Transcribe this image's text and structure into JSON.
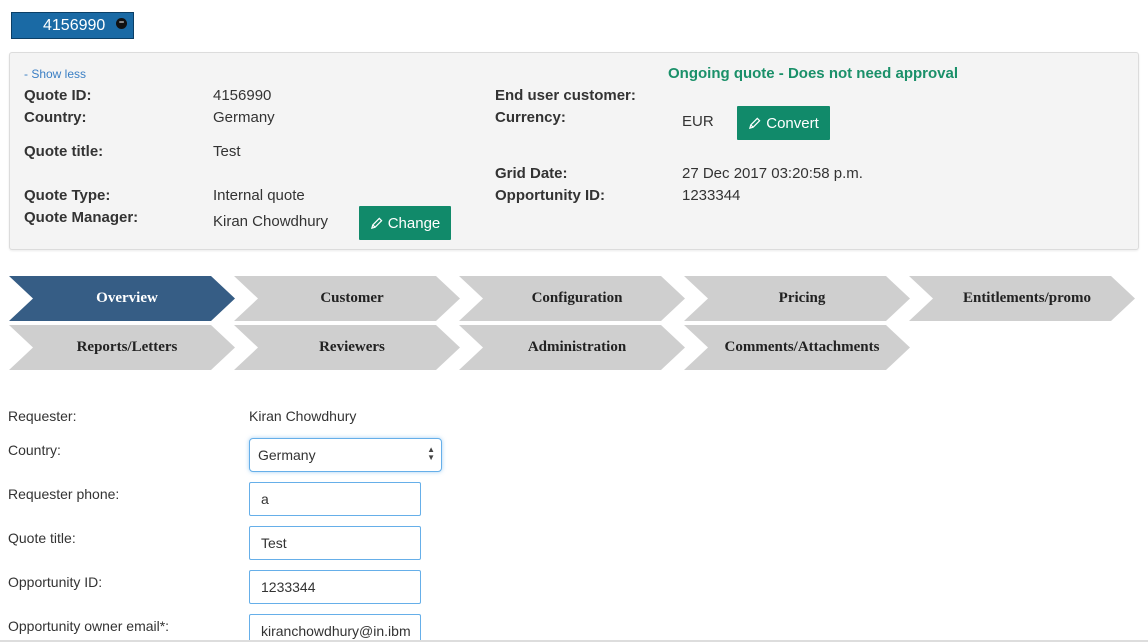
{
  "quote_tab": {
    "label": "4156990",
    "close_icon": "minus-circle-icon"
  },
  "summary": {
    "show_less": "- Show less",
    "status": "Ongoing quote - Does not need approval",
    "left": {
      "quote_id": {
        "label": "Quote ID:",
        "value": "4156990"
      },
      "country": {
        "label": "Country:",
        "value": "Germany"
      },
      "quote_title": {
        "label": "Quote title:",
        "value": "Test"
      },
      "quote_type": {
        "label": "Quote Type:",
        "value": "Internal quote"
      },
      "quote_manager": {
        "label": "Quote Manager:",
        "value": "Kiran Chowdhury",
        "button": "Change"
      }
    },
    "right": {
      "end_user": {
        "label": "End user customer:",
        "value": ""
      },
      "currency": {
        "label": "Currency:",
        "value": "EUR",
        "button": "Convert"
      },
      "grid_date": {
        "label": "Grid Date:",
        "value": "27 Dec 2017 03:20:58 p.m."
      },
      "opportunity_id": {
        "label": "Opportunity ID:",
        "value": "1233344"
      }
    }
  },
  "steps": [
    {
      "label": "Overview",
      "active": true
    },
    {
      "label": "Customer"
    },
    {
      "label": "Configuration"
    },
    {
      "label": "Pricing"
    },
    {
      "label": "Entitlements/promo"
    },
    {
      "label": "Reports/Letters"
    },
    {
      "label": "Reviewers"
    },
    {
      "label": "Administration"
    },
    {
      "label": "Comments/Attachments"
    }
  ],
  "form": {
    "requester": {
      "label": "Requester:",
      "value": "Kiran Chowdhury"
    },
    "country": {
      "label": "Country:",
      "value": "Germany"
    },
    "requester_phone": {
      "label": "Requester phone:",
      "value": "a"
    },
    "quote_title": {
      "label": "Quote title:",
      "value": "Test"
    },
    "opportunity_id": {
      "label": "Opportunity ID:",
      "value": "1233344"
    },
    "owner_email": {
      "label": "Opportunity owner email*:",
      "value": "kiranchowdhury@in.ibm"
    }
  },
  "colors": {
    "accent_green": "#118a6a",
    "status_green": "#1a9069",
    "active_step": "#365d85",
    "tab_blue": "#1a6aa5"
  }
}
